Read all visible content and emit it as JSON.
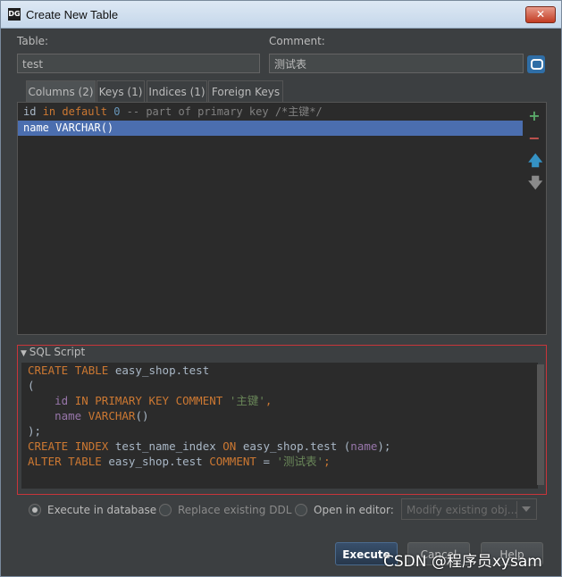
{
  "window": {
    "title": "Create New Table",
    "logo": "DG"
  },
  "form": {
    "table_label": "Table:",
    "table_value": "test",
    "comment_label": "Comment:",
    "comment_value": "测试表"
  },
  "tabs": [
    {
      "label": "Columns (2)"
    },
    {
      "label": "Keys (1)"
    },
    {
      "label": "Indices (1)"
    },
    {
      "label": "Foreign Keys"
    }
  ],
  "columns": {
    "row1": {
      "name": "id",
      "in": "in",
      "default": "default",
      "zero": "0",
      "comment": "-- part of primary key /*主键*/"
    },
    "row2": "name VARCHAR()"
  },
  "side_icons": [
    "add-icon",
    "remove-icon",
    "move-up-icon",
    "move-down-icon"
  ],
  "sql": {
    "section_label": "SQL Script",
    "l1_kw1": "CREATE",
    "l1_kw2": "TABLE",
    "l1_rest": "easy_shop.test",
    "l2": "(",
    "l3_id": "id",
    "l3_kw": "IN PRIMARY KEY COMMENT",
    "l3_str": "'主键'",
    "l3_end": ",",
    "l4_name": "name",
    "l4_kw": "VARCHAR",
    "l4_end": "()",
    "l5": ");",
    "l6_kw1": "CREATE",
    "l6_kw2": "INDEX",
    "l6_mid": "test_name_index",
    "l6_kw3": "ON",
    "l6_tbl": "easy_shop.test",
    "l6_p1": "(",
    "l6_col": "name",
    "l6_p2": ");",
    "l7_kw1": "ALTER",
    "l7_kw2": "TABLE",
    "l7_tbl": "easy_shop.test",
    "l7_kw3": "COMMENT",
    "l7_eq": "=",
    "l7_str": "'测试表'",
    "l7_end": ";"
  },
  "options": {
    "execute_in_db": "Execute in database",
    "replace_ddl": "Replace existing DDL",
    "open_editor": "Open in editor:",
    "dropdown": "Modify existing obj..."
  },
  "buttons": {
    "execute": "Execute",
    "cancel": "Cancel",
    "help": "Help"
  },
  "watermark": "CSDN @程序员xysam",
  "colors": {
    "accent": "#4b6eaf",
    "highlight_border": "#c8353a"
  }
}
